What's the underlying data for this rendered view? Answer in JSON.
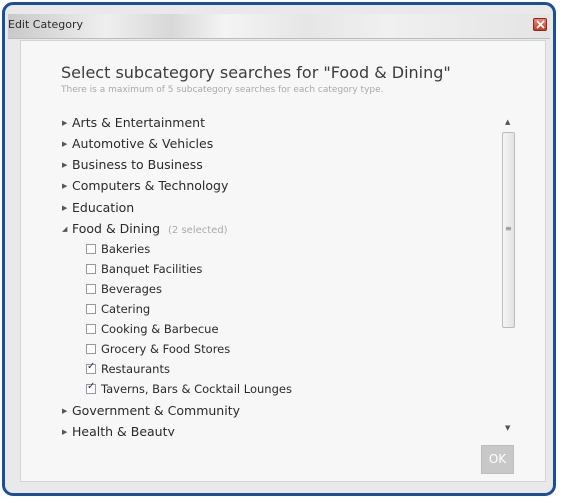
{
  "window": {
    "title": "Edit Category"
  },
  "dialog": {
    "heading": "Select subcategory searches for \"Food & Dining\"",
    "subheading": "There is a maximum of 5 subcategory searches for each category type."
  },
  "categories": [
    {
      "label": "Arts & Entertainment",
      "expanded": false
    },
    {
      "label": "Automotive & Vehicles",
      "expanded": false
    },
    {
      "label": "Business to Business",
      "expanded": false
    },
    {
      "label": "Computers & Technology",
      "expanded": false
    },
    {
      "label": "Education",
      "expanded": false
    },
    {
      "label": "Food & Dining",
      "expanded": true,
      "count": "(2 selected)"
    },
    {
      "label": "Government & Community",
      "expanded": false
    },
    {
      "label": "Health & Beauty",
      "expanded": false
    }
  ],
  "subcategories": [
    {
      "label": "Bakeries",
      "checked": false
    },
    {
      "label": "Banquet Facilities",
      "checked": false
    },
    {
      "label": "Beverages",
      "checked": false
    },
    {
      "label": "Catering",
      "checked": false
    },
    {
      "label": "Cooking & Barbecue",
      "checked": false
    },
    {
      "label": "Grocery & Food Stores",
      "checked": false
    },
    {
      "label": "Restaurants",
      "checked": true
    },
    {
      "label": "Taverns, Bars & Cocktail Lounges",
      "checked": true
    }
  ],
  "ok_label": "OK"
}
